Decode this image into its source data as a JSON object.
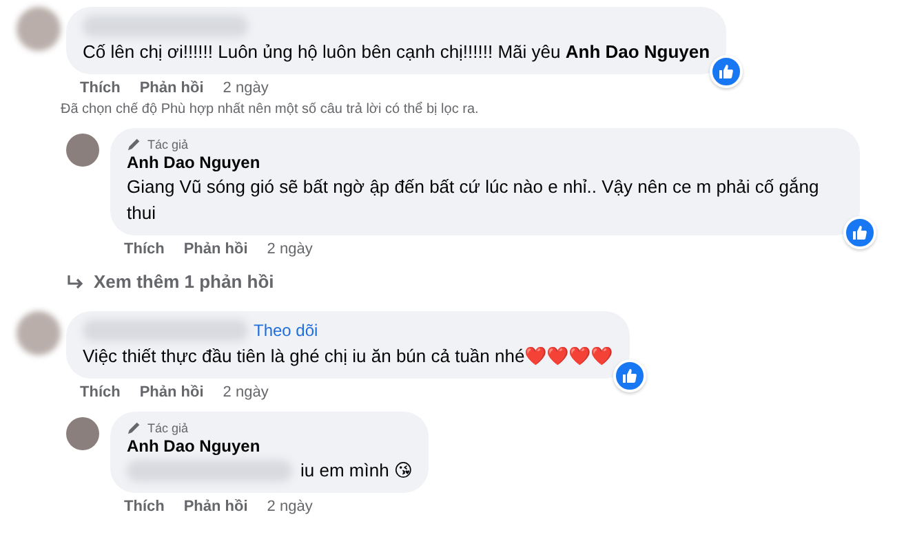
{
  "comments": [
    {
      "author_hidden": true,
      "text": "Cố lên chị ơi!!!!!! Luôn ủng hộ luôn bên cạnh chị!!!!!! Mãi yêu **Anh Dao Nguyen**",
      "liked": true,
      "actions": [
        "Thích",
        "Phản hồi"
      ],
      "time": "2 ngày",
      "notice": "Đã chọn chế độ Phù hợp nhất nên một số câu trả lời có thể bị lọc ra.",
      "children": [
        {
          "author_badge": "Tác giả",
          "author": "Anh Dao Nguyen",
          "text": "Giang Vũ sóng gió sẽ bất ngờ ập đến bất cứ lúc nào e nhỉ.. Vậy nên ce m phải cố gắng thui",
          "liked": true,
          "actions": [
            "Thích",
            "Phản hồi"
          ],
          "time": "2 ngày"
        }
      ],
      "more_replies": "Xem thêm 1 phản hồi"
    },
    {
      "author_hidden": true,
      "follow_link": "Theo dõi",
      "text": "Việc thiết thực đầu tiên là ghé chị iu ăn bún cả tuần nhé❤️❤️❤️❤️",
      "liked": true,
      "actions": [
        "Thích",
        "Phản hồi"
      ],
      "time": "2 ngày",
      "children": [
        {
          "author_badge": "Tác giả",
          "author": "Anh Dao Nguyen",
          "text": "iu em mình 😘",
          "text_hidden_prefix": true,
          "liked": false,
          "actions": [
            "Thích",
            "Phản hồi"
          ],
          "time": "2 ngày"
        }
      ]
    }
  ]
}
